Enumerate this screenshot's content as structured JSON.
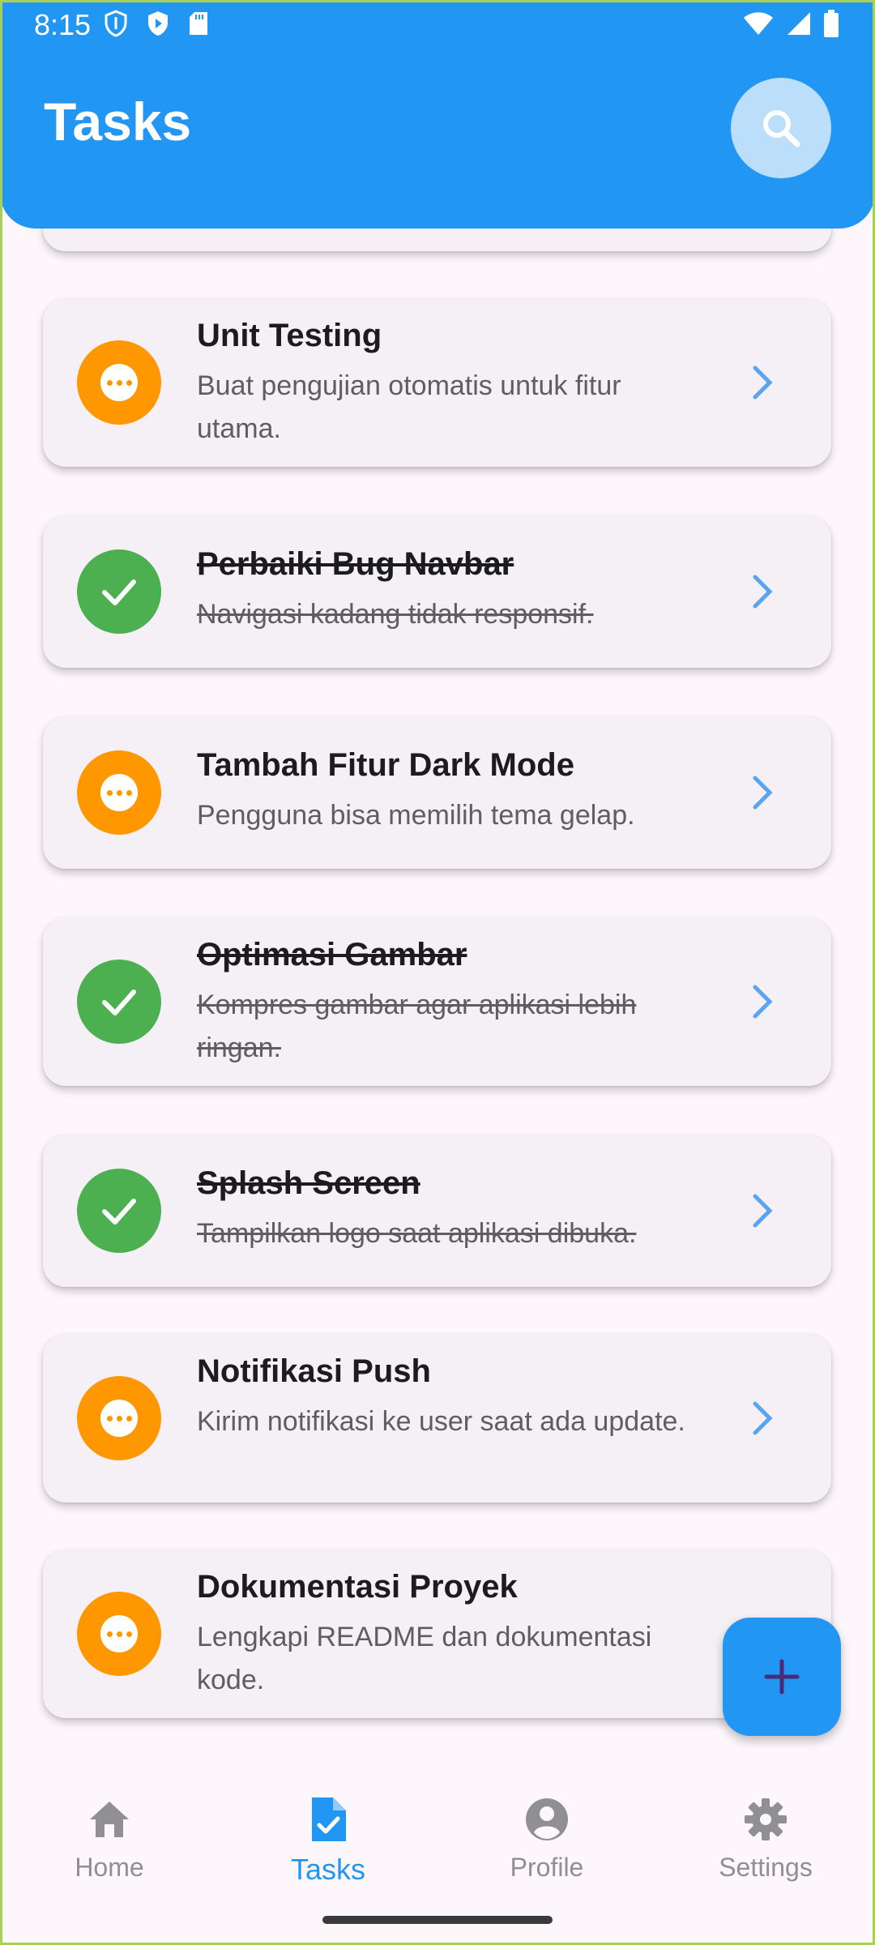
{
  "status_bar": {
    "time": "8:15"
  },
  "header": {
    "title": "Tasks"
  },
  "colors": {
    "primary": "#2196f3",
    "pending": "#ff9800",
    "done": "#4caf50",
    "background": "#fdf7fc"
  },
  "tasks": [
    {
      "title": "Unit Testing",
      "description": "Buat pengujian otomatis untuk fitur utama.",
      "status": "pending"
    },
    {
      "title": "Perbaiki Bug Navbar",
      "description": "Navigasi kadang tidak responsif.",
      "status": "done"
    },
    {
      "title": "Tambah Fitur Dark Mode",
      "description": "Pengguna bisa memilih tema gelap.",
      "status": "pending"
    },
    {
      "title": "Optimasi Gambar",
      "description": "Kompres gambar agar aplikasi lebih ringan.",
      "status": "done"
    },
    {
      "title": "Splash Screen",
      "description": "Tampilkan logo saat aplikasi dibuka.",
      "status": "done"
    },
    {
      "title": "Notifikasi Push",
      "description": "Kirim notifikasi ke user saat ada update.",
      "status": "pending"
    },
    {
      "title": "Dokumentasi Proyek",
      "description": "Lengkapi README dan dokumentasi kode.",
      "status": "pending"
    }
  ],
  "nav": {
    "home": "Home",
    "tasks": "Tasks",
    "profile": "Profile",
    "settings": "Settings",
    "active": "tasks"
  }
}
